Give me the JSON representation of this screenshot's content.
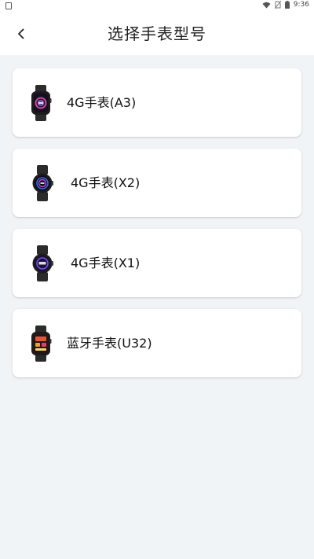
{
  "status_bar": {
    "time": "9:36",
    "icons": [
      "notification-icon",
      "wifi-icon",
      "no-sim-icon",
      "battery-icon"
    ]
  },
  "header": {
    "back_icon": "chevron-left-icon",
    "title": "选择手表型号"
  },
  "models": [
    {
      "label": "4G手表(A3)",
      "icon": "watch-square-icon"
    },
    {
      "label": "4G手表(X2)",
      "icon": "watch-round-icon"
    },
    {
      "label": "4G手表(X1)",
      "icon": "watch-round-icon"
    },
    {
      "label": "蓝牙手表(U32)",
      "icon": "watch-square-icon"
    }
  ],
  "colors": {
    "background": "#f1f4f6",
    "card": "#ffffff",
    "text": "#222222"
  }
}
